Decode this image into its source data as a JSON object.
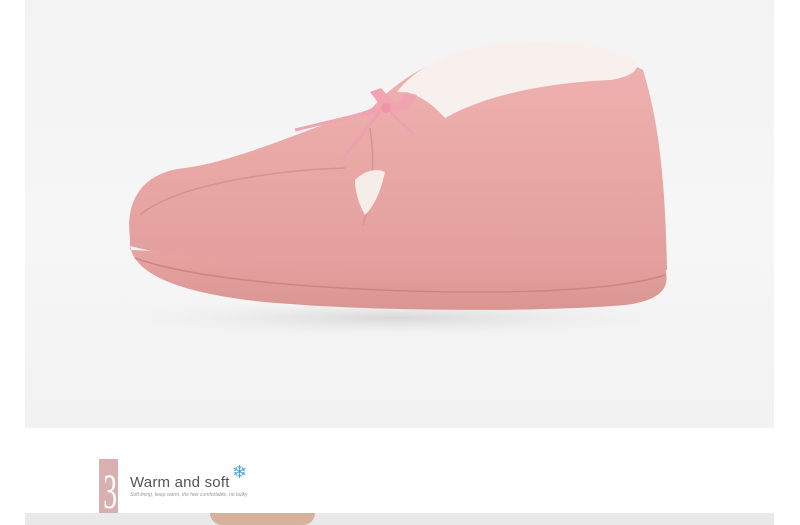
{
  "section": {
    "number": "3",
    "title": "Warm and soft",
    "icon": "snowflake-icon",
    "subtitle": "Soft lining, keep warm, the feet comfortable, no bulky"
  },
  "colors": {
    "accent_pink": "#d9b0b0",
    "slipper_pink": "#eaa8a8",
    "snowflake_blue": "#4aa6d9"
  }
}
